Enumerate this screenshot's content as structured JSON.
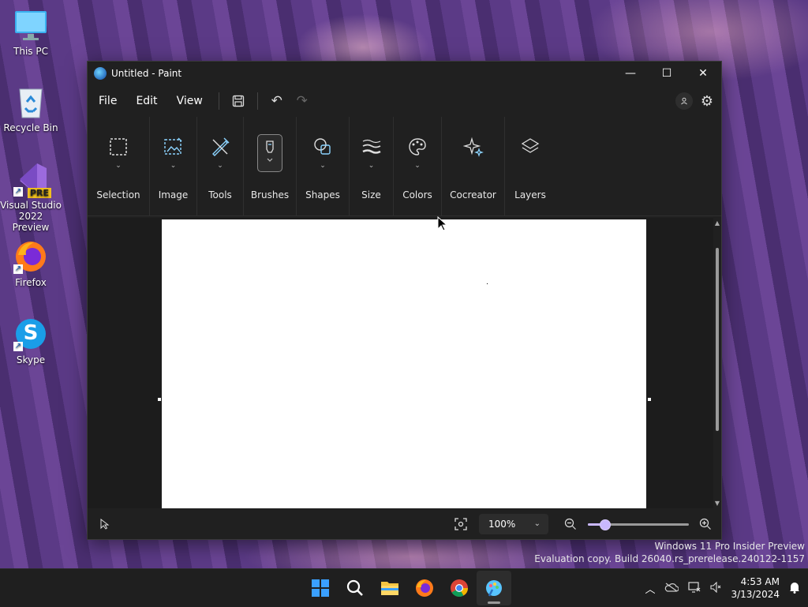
{
  "desktop": {
    "icons": [
      {
        "label": "This PC",
        "icon": "monitor-icon"
      },
      {
        "label": "Recycle Bin",
        "icon": "recycle-bin-icon"
      },
      {
        "label": "Visual Studio 2022 Preview",
        "badge": "PRE",
        "icon": "visual-studio-icon"
      },
      {
        "label": "Firefox",
        "icon": "firefox-icon"
      },
      {
        "label": "Skype",
        "badge": "S",
        "icon": "skype-icon"
      }
    ]
  },
  "window": {
    "title": "Untitled - Paint",
    "controls": {
      "minimize": "—",
      "maximize": "☐",
      "close": "✕"
    }
  },
  "menu": {
    "items": [
      "File",
      "Edit",
      "View"
    ],
    "save_icon": "💾",
    "undo_icon": "↶",
    "redo_icon": "↷"
  },
  "ribbon": {
    "groups": [
      {
        "label": "Selection",
        "icon": "selection-icon"
      },
      {
        "label": "Image",
        "icon": "image-icon"
      },
      {
        "label": "Tools",
        "icon": "tools-icon"
      },
      {
        "label": "Brushes",
        "icon": "brushes-icon",
        "active": true
      },
      {
        "label": "Shapes",
        "icon": "shapes-icon"
      },
      {
        "label": "Size",
        "icon": "size-icon"
      },
      {
        "label": "Colors",
        "icon": "colors-icon"
      },
      {
        "label": "Cocreator",
        "icon": "cocreator-icon"
      },
      {
        "label": "Layers",
        "icon": "layers-icon"
      }
    ]
  },
  "statusbar": {
    "zoom_value": "100%",
    "zoom_level": 0.17
  },
  "watermark": {
    "line1": "Windows 11 Pro Insider Preview",
    "line2": "Evaluation copy. Build 26040.rs_prerelease.240122-1157"
  },
  "taskbar": {
    "apps": [
      "start-icon",
      "search-icon",
      "file-explorer-icon",
      "firefox-icon",
      "chrome-icon",
      "paint-icon"
    ],
    "time": "4:53 AM",
    "date": "3/13/2024"
  },
  "colors": {
    "accent": "#c9b8ff",
    "window_bg": "#202020",
    "canvas": "#ffffff"
  }
}
